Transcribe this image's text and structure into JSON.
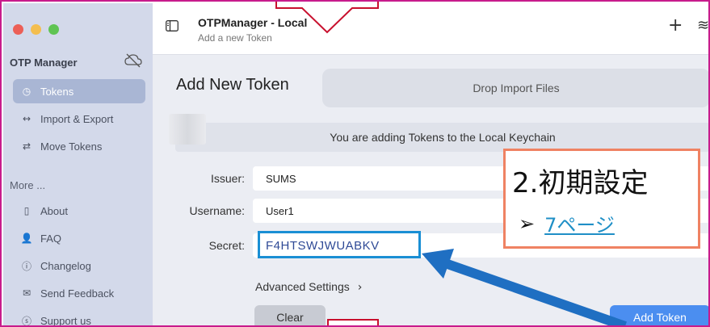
{
  "sidebar": {
    "section_title": "OTP Manager",
    "more_title": "More ...",
    "items": [
      {
        "label": "Tokens",
        "icon": "timer-icon"
      },
      {
        "label": "Import & Export",
        "icon": "arrows-icon"
      },
      {
        "label": "Move Tokens",
        "icon": "move-icon"
      },
      {
        "label": "About",
        "icon": "panel-icon"
      },
      {
        "label": "FAQ",
        "icon": "person-question-icon"
      },
      {
        "label": "Changelog",
        "icon": "info-icon"
      },
      {
        "label": "Send Feedback",
        "icon": "mail-icon"
      },
      {
        "label": "Support us",
        "icon": "dollar-icon"
      }
    ]
  },
  "header": {
    "title": "OTPManager - Local",
    "subtitle": "Add a new Token"
  },
  "main": {
    "heading": "Add New Token",
    "drop_zone": "Drop Import Files",
    "keychain_notice": "You are adding Tokens to the Local Keychain",
    "form": {
      "issuer_label": "Issuer:",
      "issuer_value": "SUMS",
      "username_label": "Username:",
      "username_value": "User1",
      "secret_label": "Secret:",
      "secret_value": "F4HTSWJWUABKV"
    },
    "advanced_label": "Advanced Settings",
    "clear_label": "Clear",
    "add_label": "Add Token"
  },
  "callout": {
    "title": "2.初期設定",
    "bullet": "➢",
    "link": "7ページ"
  },
  "colors": {
    "frame": "#c81b8c",
    "accent_blue": "#4b8ef0",
    "callout_border": "#ef8263",
    "arrow_blue": "#1f6fc2",
    "top_arrow": "#c8102e"
  }
}
